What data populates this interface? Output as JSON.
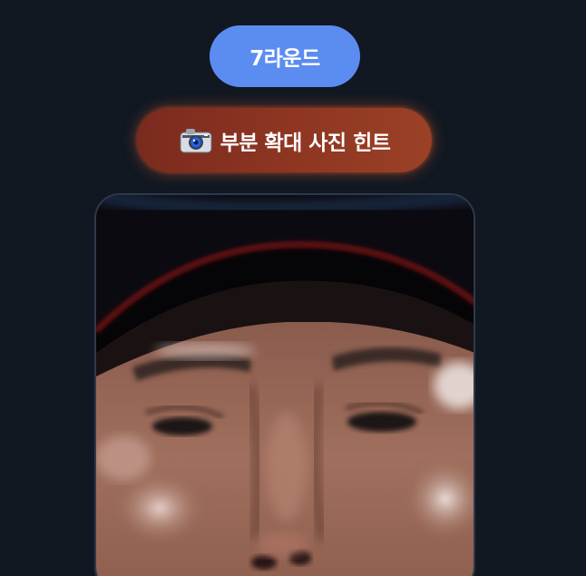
{
  "round": {
    "label": "7라운드"
  },
  "hint": {
    "icon": "camera-icon",
    "label": "부분 확대 사진 힌트"
  },
  "photo": {
    "description_icon": "zoomed-face-photo"
  },
  "colors": {
    "background": "#111822",
    "round_pill": "#5b8cf0",
    "hint_pill": "#8e3522",
    "frame_border": "#2e3a4a"
  }
}
